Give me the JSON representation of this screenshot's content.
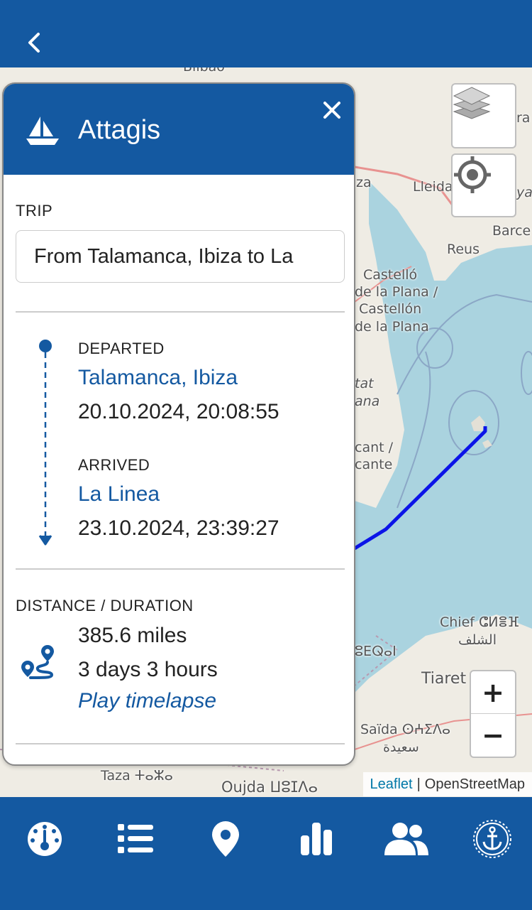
{
  "app": {
    "header": {
      "back_icon": "chevron-left-icon"
    },
    "colors": {
      "primary": "#1459a1",
      "sea": "#aad3df",
      "route": "#0b14e8"
    }
  },
  "map": {
    "labels": [
      "Bilbao",
      "Lleida",
      "Barce",
      "Reus",
      "Castelló",
      "de la Plana /",
      "Castellón",
      "de la Plana",
      "za",
      "tat",
      "ana",
      "cant /",
      "cante",
      "Chief ⵛⵍⴻⴼ",
      "الشلف",
      "Tiaret",
      "Saïda ⵙⵄⵉⴷⴰ",
      "سعيدة",
      "Taza ⵜⴰⵣⴰ",
      "Oujda ⵡⵓⵊⴷⴰ",
      "ra",
      "ya",
      "ⵓⴹⵕⴰⵏ"
    ],
    "zoom_in": "+",
    "zoom_out": "−",
    "attribution": {
      "leaflet": "Leaflet",
      "separator": "|",
      "osm": "OpenStreetMap"
    }
  },
  "panel": {
    "title": "Attagis",
    "trip_label": "TRIP",
    "trip_value": "From Talamanca, Ibiza to La",
    "departed": {
      "heading": "DEPARTED",
      "place": "Talamanca, Ibiza",
      "time": "20.10.2024, 20:08:55"
    },
    "arrived": {
      "heading": "ARRIVED",
      "place": "La Linea",
      "time": "23.10.2024, 23:39:27"
    },
    "distance_label": "DISTANCE / DURATION",
    "distance": "385.6 miles",
    "duration": "3 days 3 hours",
    "timelapse": "Play timelapse"
  },
  "bottom_nav": {
    "items": [
      {
        "name": "dashboard",
        "icon": "gauge-icon"
      },
      {
        "name": "list",
        "icon": "list-icon"
      },
      {
        "name": "location",
        "icon": "map-pin-icon"
      },
      {
        "name": "stats",
        "icon": "bar-chart-icon"
      },
      {
        "name": "crew",
        "icon": "users-icon"
      },
      {
        "name": "anchor",
        "icon": "anchor-icon"
      }
    ]
  }
}
